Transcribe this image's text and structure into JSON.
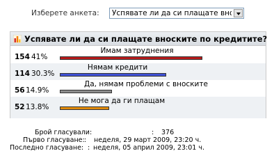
{
  "selector": {
    "label": "Изберете анкета:",
    "value": "Успявате ли да си плащате вноските по кредитите?"
  },
  "poll": {
    "title": "Успявате ли да си плащате вноските по кредитите?",
    "options": [
      {
        "label": "Имам затруднения",
        "count": "154",
        "percent": "41%",
        "color": "#b71c1c"
      },
      {
        "label": "Нямам кредити",
        "count": "114",
        "percent": "30.3%",
        "color": "#3f51d6"
      },
      {
        "label": "Да, нямам проблеми с вноските",
        "count": "56",
        "percent": "14.9%",
        "color": "#8d8d8d"
      },
      {
        "label": "Не мога да ги плащам",
        "count": "52",
        "percent": "13.8%",
        "color": "#e08a0c"
      }
    ]
  },
  "stats": {
    "votes_label": "Брой гласували:",
    "votes_value": "376",
    "first_label": "Първо гласуване:",
    "first_value": "неделя, 29 март 2009, 23:20 ч.",
    "last_label": "Последно гласуване:",
    "last_value": "неделя, 05 април 2009, 23:01 ч."
  }
}
